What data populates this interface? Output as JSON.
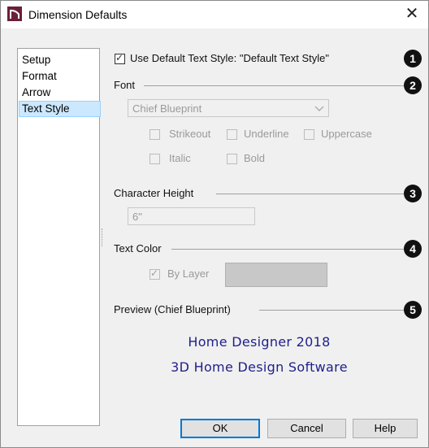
{
  "window": {
    "title": "Dimension Defaults"
  },
  "sidebar": {
    "items": [
      {
        "label": "Setup",
        "selected": false
      },
      {
        "label": "Format",
        "selected": false
      },
      {
        "label": "Arrow",
        "selected": false
      },
      {
        "label": "Text Style",
        "selected": true
      }
    ]
  },
  "text_style": {
    "use_default_label": "Use Default Text Style: \"Default Text Style\"",
    "use_default_checked": true,
    "font_section": "Font",
    "font_value": "Chief Blueprint",
    "options": {
      "strikeout": "Strikeout",
      "underline": "Underline",
      "uppercase": "Uppercase",
      "italic": "Italic",
      "bold": "Bold"
    },
    "height_section": "Character Height",
    "height_value": "6\"",
    "color_section": "Text Color",
    "by_layer_label": "By Layer",
    "by_layer_checked": true,
    "swatch_color": "#c8c8c8",
    "preview_section": "Preview (Chief Blueprint)",
    "preview_line1": "Home Designer 2018",
    "preview_line2": "3D Home Design Software"
  },
  "callouts": [
    "1",
    "2",
    "3",
    "4",
    "5"
  ],
  "buttons": {
    "ok": "OK",
    "cancel": "Cancel",
    "help": "Help"
  },
  "colors": {
    "accent": "#0078d7",
    "selection": "#cce8ff",
    "preview_text": "#1f1f8a",
    "callout": "#111111"
  }
}
